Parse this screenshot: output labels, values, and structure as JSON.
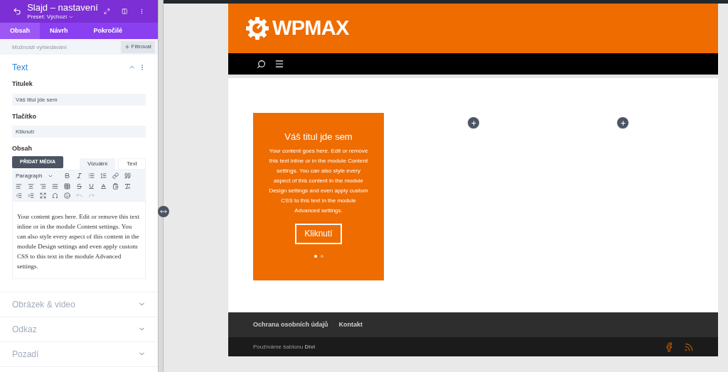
{
  "panel": {
    "title": "Slajd – nastavení",
    "preset": "Preset: Výchozí",
    "tabs": [
      {
        "label": "Obsah",
        "selected": true
      },
      {
        "label": "Návrh",
        "selected": false
      },
      {
        "label": "Pokročilé",
        "selected": false
      }
    ],
    "search": {
      "placeholder": "Možnosti vyhledávání"
    },
    "filter_button": "Filtrovat",
    "sections": [
      {
        "title": "Text",
        "expanded": true
      },
      {
        "title": "Obrázek & video",
        "expanded": false
      },
      {
        "title": "Odkaz",
        "expanded": false
      },
      {
        "title": "Pozadí",
        "expanded": false
      }
    ],
    "fields": [
      {
        "label": "Titulek",
        "value": "Váš titul jde sem"
      },
      {
        "label": "Tlačítko",
        "value": "Kliknutí"
      }
    ],
    "content_label": "Obsah",
    "add_media": "PŘIDAT MÉDIA",
    "editor_tabs": [
      {
        "label": "Vizuální",
        "selected": true
      },
      {
        "label": "Text",
        "selected": false
      }
    ],
    "format_select": "Paragraph",
    "editor_text": "Your content goes here. Edit or remove this text inline or in the module Content settings. You can also style every aspect of this content in the module Design settings and even apply custom CSS to this text in the module Advanced settings."
  },
  "page": {
    "logo": "WPMAX",
    "slide": {
      "title": "Váš titul jde sem",
      "text": "Your content goes here. Edit or remove this text inline or in the module Content settings. You can also style every aspect of this content in the module Design settings and even apply custom CSS to this text in the module Advanced settings.",
      "button": "Kliknutí",
      "dots": [
        {
          "selected": true
        },
        {
          "selected": false
        }
      ]
    },
    "footer_links": [
      "Ochrana osobních údajů",
      "Kontakt"
    ],
    "credit": "Používáme šablonu **Divi**"
  }
}
